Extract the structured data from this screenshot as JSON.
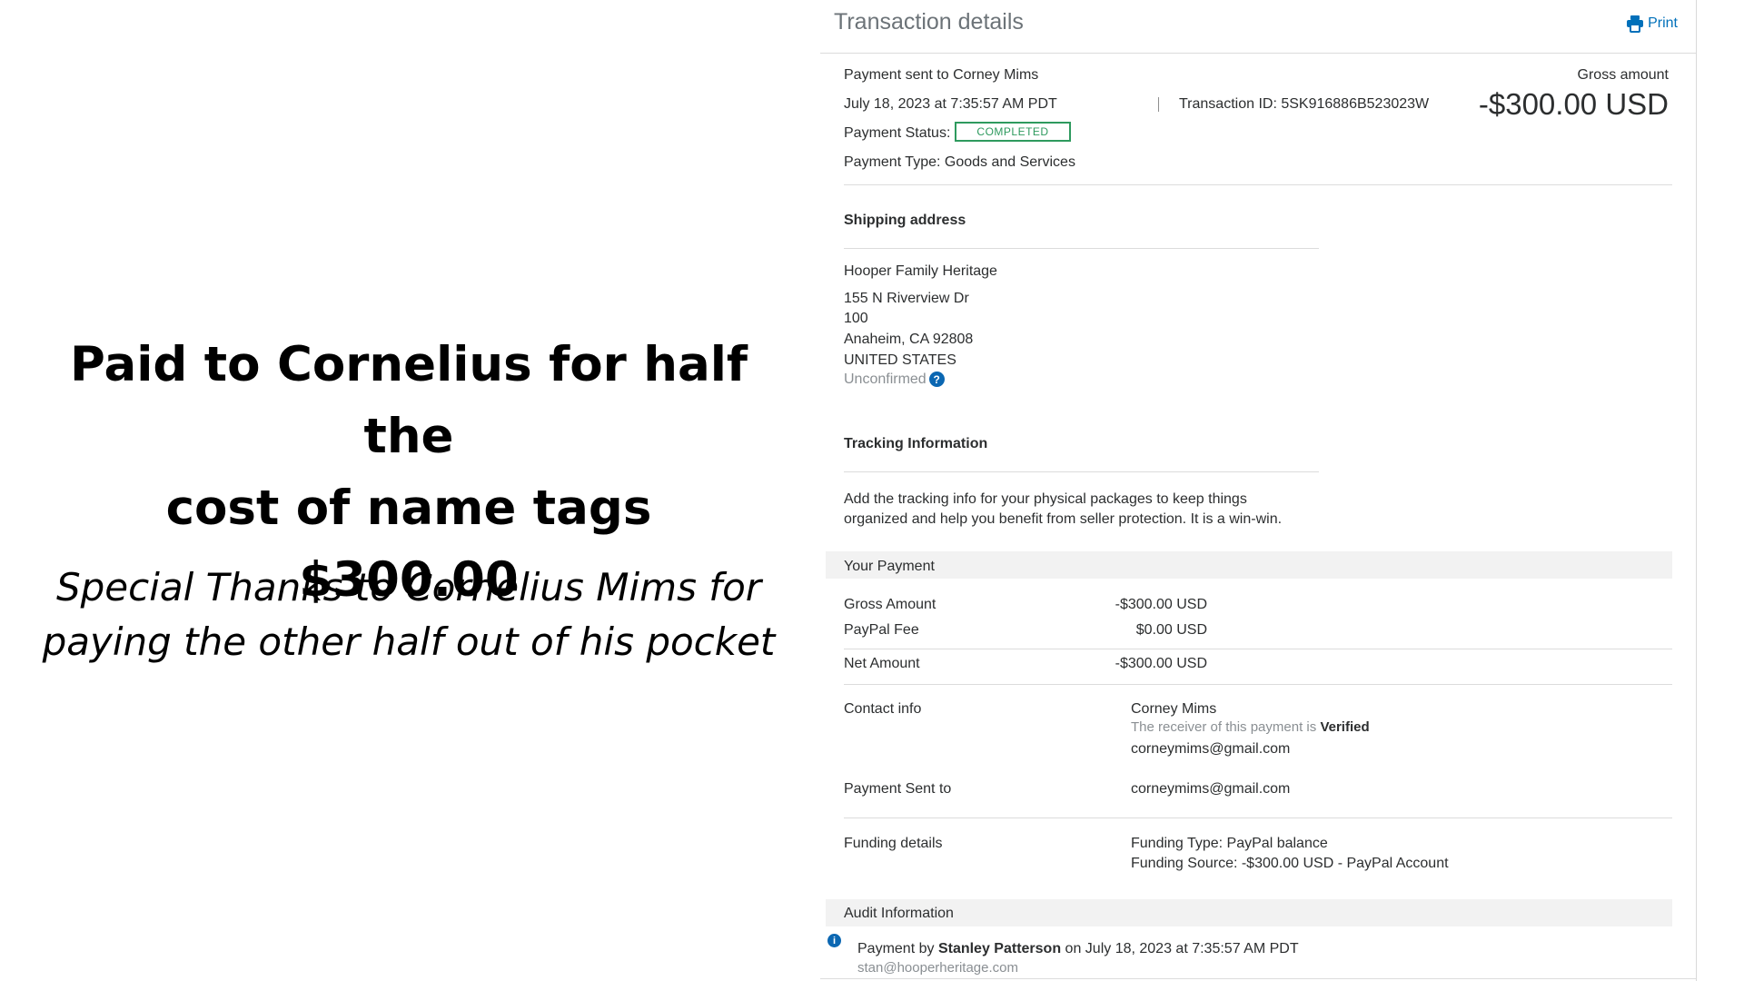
{
  "caption": {
    "title_lines": [
      "Paid to Cornelius for half the",
      "cost of name tags",
      "$300.00"
    ],
    "subtitle_lines": [
      "Special Thanks to Cornelius Mims for",
      "paying the other half out of his pocket"
    ]
  },
  "panel": {
    "title": "Transaction details",
    "print_label": "Print",
    "payment_sent_to": "Payment sent to Corney Mims",
    "datetime": "July 18, 2023 at 7:35:57 AM PDT",
    "transaction_id": "Transaction ID: 5SK916886B523023W",
    "gross_label": "Gross amount",
    "gross_value": "-$300.00 USD",
    "status_label": "Payment Status:",
    "status_value": "COMPLETED",
    "payment_type": "Payment Type: Goods and Services"
  },
  "shipping": {
    "heading": "Shipping address",
    "name": "Hooper Family Heritage",
    "street": "155 N Riverview Dr",
    "unit": "100",
    "city": "Anaheim, CA 92808",
    "country": "UNITED STATES",
    "status": "Unconfirmed",
    "help_glyph": "?"
  },
  "tracking": {
    "heading": "Tracking Information",
    "line1": "Add the tracking info for your physical packages to keep things",
    "line2": "organized and help you benefit from seller protection. It is a win-win."
  },
  "your_payment": {
    "heading": "Your Payment",
    "rows": [
      {
        "label": "Gross Amount",
        "value": "-$300.00 USD"
      },
      {
        "label": "PayPal Fee",
        "value": "$0.00 USD"
      },
      {
        "label": "Net Amount",
        "value": "-$300.00 USD"
      }
    ]
  },
  "contact": {
    "label": "Contact info",
    "name": "Corney Mims",
    "verified_prefix": "The receiver of this payment is",
    "verified_word": "Verified",
    "email": "corneymims@gmail.com",
    "sent_to_label": "Payment Sent to",
    "sent_to_value": "corneymims@gmail.com"
  },
  "funding": {
    "label": "Funding details",
    "type": "Funding Type: PayPal balance",
    "source": "Funding Source: -$300.00 USD - PayPal Account"
  },
  "audit": {
    "heading": "Audit Information",
    "icon_glyph": "i",
    "prefix": "Payment by",
    "name": "Stanley Patterson",
    "suffix": "on July 18, 2023 at 7:35:57 AM PDT",
    "email": "stan@hooperheritage.com"
  },
  "colors": {
    "link_blue": "#0070ba",
    "completed_green": "#2e9a5e",
    "info_blue": "#0b67b2"
  },
  "icons": [
    "printer-icon",
    "help-icon",
    "info-icon"
  ]
}
